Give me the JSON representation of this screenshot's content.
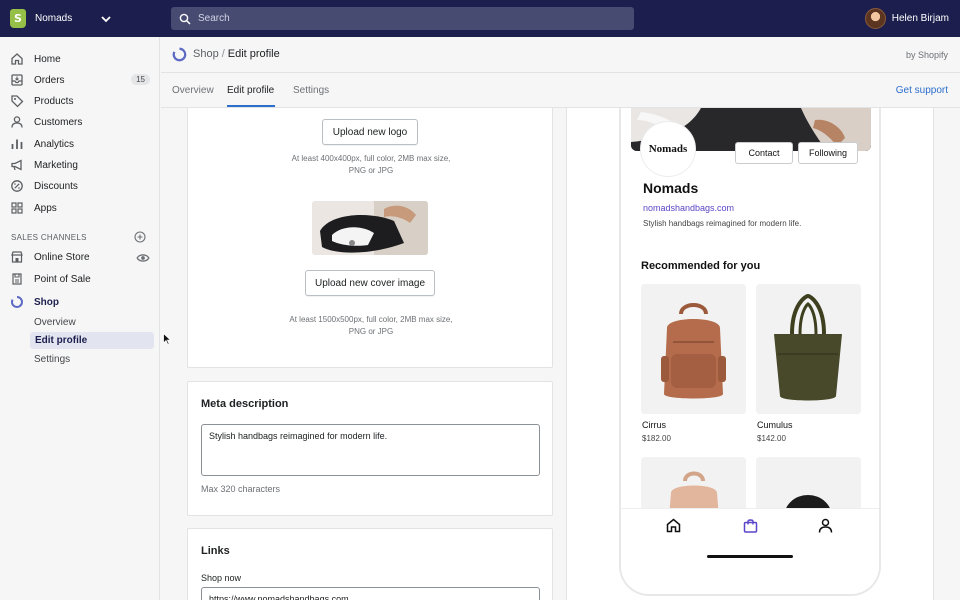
{
  "topbar": {
    "store_name": "Nomads",
    "search_placeholder": "Search",
    "user_name": "Helen Birjam",
    "brand_color": "#1c1f4d"
  },
  "sidebar": {
    "items": [
      {
        "label": "Home",
        "icon": "home-icon"
      },
      {
        "label": "Orders",
        "icon": "orders-icon",
        "badge": "15"
      },
      {
        "label": "Products",
        "icon": "tag-icon"
      },
      {
        "label": "Customers",
        "icon": "person-icon"
      },
      {
        "label": "Analytics",
        "icon": "bar-chart-icon"
      },
      {
        "label": "Marketing",
        "icon": "megaphone-icon"
      },
      {
        "label": "Discounts",
        "icon": "discount-icon"
      },
      {
        "label": "Apps",
        "icon": "apps-icon"
      }
    ],
    "sales_channels_heading": "SALES CHANNELS",
    "channels": [
      {
        "label": "Online Store",
        "icon": "store-icon"
      },
      {
        "label": "Point of Sale",
        "icon": "pos-icon"
      },
      {
        "label": "Shop",
        "icon": "shop-icon"
      }
    ],
    "shop_subitems": [
      "Overview",
      "Edit profile",
      "Settings"
    ]
  },
  "header": {
    "breadcrumb_parent": "Shop",
    "breadcrumb_sep": "/",
    "breadcrumb_current": "Edit profile",
    "byline": "by Shopify"
  },
  "tabs": [
    {
      "label": "Overview",
      "active": false
    },
    {
      "label": "Edit profile",
      "active": true
    },
    {
      "label": "Settings",
      "active": false
    }
  ],
  "support_link": "Get support",
  "images_card": {
    "upload_logo_label": "Upload new logo",
    "logo_hint_1": "At least 400x400px, full color, 2MB max size,",
    "logo_hint_2": "PNG or JPG",
    "upload_cover_label": "Upload new cover image",
    "cover_hint_1": "At least 1500x500px, full color, 2MB max size,",
    "cover_hint_2": "PNG or JPG"
  },
  "meta_card": {
    "title": "Meta description",
    "value": "Stylish handbags reimagined for modern life.",
    "helper": "Max 320 characters"
  },
  "links_card": {
    "title": "Links",
    "shop_now_label": "Shop now",
    "shop_now_value": "https://www.nomadshandbags.com"
  },
  "preview": {
    "logo_text": "Nomads",
    "contact_label": "Contact",
    "following_label": "Following",
    "store_name": "Nomads",
    "store_url": "nomadshandbags.com",
    "description": "Stylish handbags reimagined for modern life.",
    "recommended_heading": "Recommended for you",
    "products": [
      {
        "name": "Cirrus",
        "price": "$182.00"
      },
      {
        "name": "Cumulus",
        "price": "$142.00"
      }
    ],
    "link_color": "#5c45c8"
  }
}
